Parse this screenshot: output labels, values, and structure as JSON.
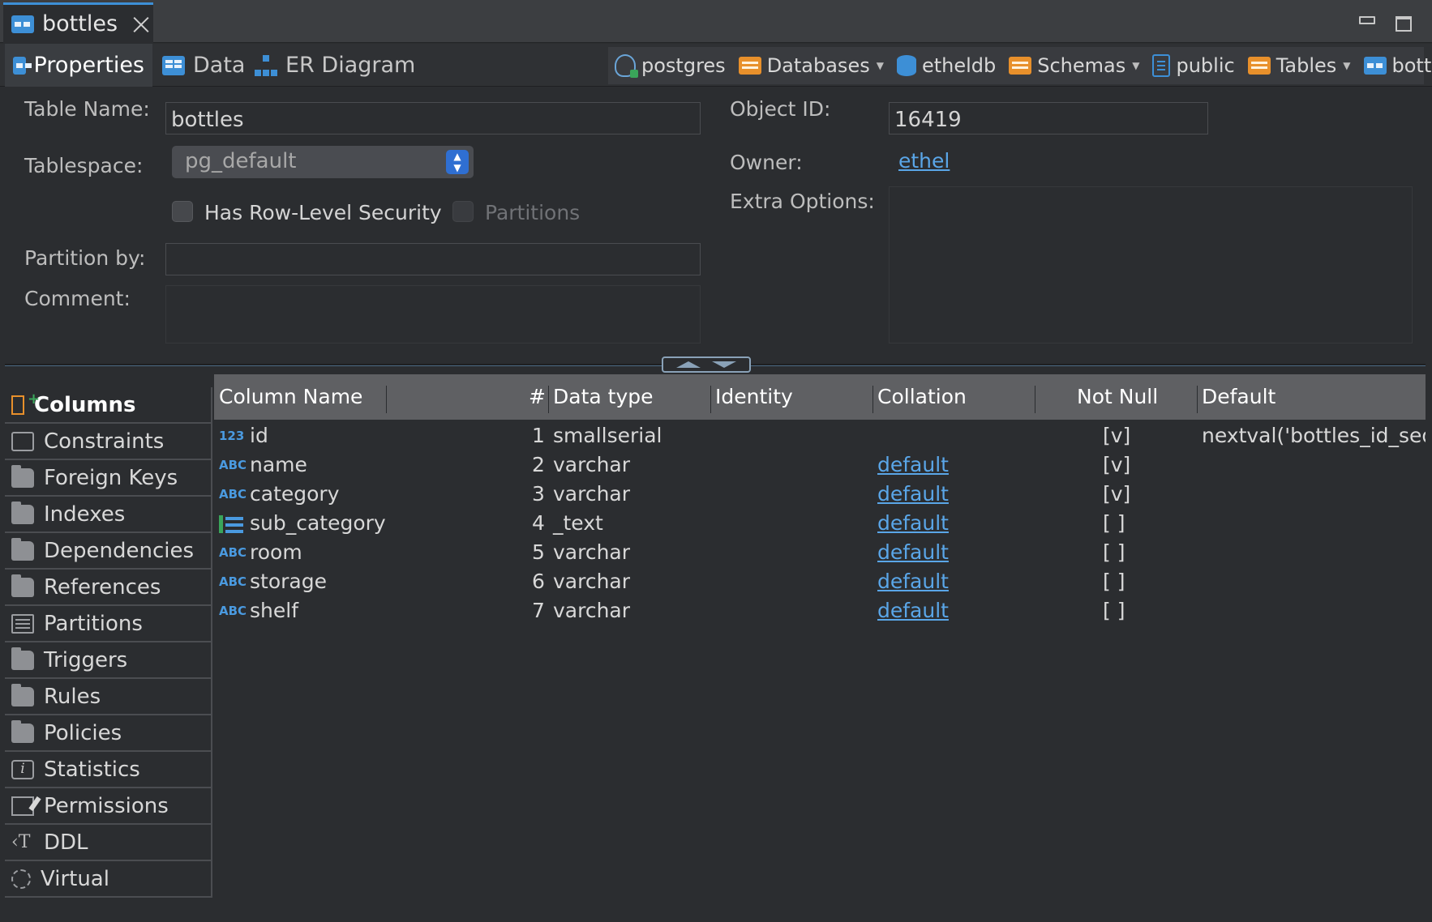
{
  "editor_tab": {
    "title": "bottles"
  },
  "sub_tabs": [
    {
      "label": "Properties",
      "active": true
    },
    {
      "label": "Data"
    },
    {
      "label": "ER Diagram"
    }
  ],
  "breadcrumbs": [
    {
      "label": "postgres",
      "icon": "postgres-icon",
      "dropdown": false
    },
    {
      "label": "Databases",
      "icon": "databases-folder-icon",
      "dropdown": true
    },
    {
      "label": "etheldb",
      "icon": "database-icon",
      "dropdown": false
    },
    {
      "label": "Schemas",
      "icon": "schemas-folder-icon",
      "dropdown": true
    },
    {
      "label": "public",
      "icon": "schema-icon",
      "dropdown": false
    },
    {
      "label": "Tables",
      "icon": "tables-folder-icon",
      "dropdown": true
    },
    {
      "label": "bottles",
      "icon": "table-icon",
      "dropdown": false
    }
  ],
  "form": {
    "table_name_label": "Table Name:",
    "table_name_value": "bottles",
    "tablespace_label": "Tablespace:",
    "tablespace_value": "pg_default",
    "row_level_security_label": "Has Row-Level Security",
    "partitions_label": "Partitions",
    "partition_by_label": "Partition by:",
    "partition_by_value": "",
    "comment_label": "Comment:",
    "comment_value": "",
    "object_id_label": "Object ID:",
    "object_id_value": "16419",
    "owner_label": "Owner:",
    "owner_value": "ethel",
    "extra_options_label": "Extra Options:",
    "extra_options_value": ""
  },
  "sections": [
    {
      "label": "Columns",
      "icon": "columns-icon",
      "active": true
    },
    {
      "label": "Constraints",
      "icon": "constraints-icon"
    },
    {
      "label": "Foreign Keys",
      "icon": "folder-icon"
    },
    {
      "label": "Indexes",
      "icon": "folder-icon"
    },
    {
      "label": "Dependencies",
      "icon": "folder-icon"
    },
    {
      "label": "References",
      "icon": "folder-icon"
    },
    {
      "label": "Partitions",
      "icon": "partitions-icon"
    },
    {
      "label": "Triggers",
      "icon": "folder-icon"
    },
    {
      "label": "Rules",
      "icon": "folder-icon"
    },
    {
      "label": "Policies",
      "icon": "folder-icon"
    },
    {
      "label": "Statistics",
      "icon": "info-icon"
    },
    {
      "label": "Permissions",
      "icon": "permissions-icon"
    },
    {
      "label": "DDL",
      "icon": "ddl-icon"
    },
    {
      "label": "Virtual",
      "icon": "virtual-icon"
    }
  ],
  "columns_table": {
    "headers": {
      "name": "Column Name",
      "num": "#",
      "type": "Data type",
      "identity": "Identity",
      "collation": "Collation",
      "not_null": "Not Null",
      "default": "Default"
    },
    "rows": [
      {
        "type_icon": "123",
        "name": "id",
        "num": "1",
        "type": "smallserial",
        "collation": "",
        "not_null": "[v]",
        "default": "nextval('bottles_id_seq"
      },
      {
        "type_icon": "ABC",
        "name": "name",
        "num": "2",
        "type": "varchar",
        "collation": "default",
        "not_null": "[v]",
        "default": ""
      },
      {
        "type_icon": "ABC",
        "name": "category",
        "num": "3",
        "type": "varchar",
        "collation": "default",
        "not_null": "[v]",
        "default": ""
      },
      {
        "type_icon": "array",
        "name": "sub_category",
        "num": "4",
        "type": "_text",
        "collation": "default",
        "not_null": "[ ]",
        "default": ""
      },
      {
        "type_icon": "ABC",
        "name": "room",
        "num": "5",
        "type": "varchar",
        "collation": "default",
        "not_null": "[ ]",
        "default": ""
      },
      {
        "type_icon": "ABC",
        "name": "storage",
        "num": "6",
        "type": "varchar",
        "collation": "default",
        "not_null": "[ ]",
        "default": ""
      },
      {
        "type_icon": "ABC",
        "name": "shelf",
        "num": "7",
        "type": "varchar",
        "collation": "default",
        "not_null": "[ ]",
        "default": ""
      }
    ]
  }
}
